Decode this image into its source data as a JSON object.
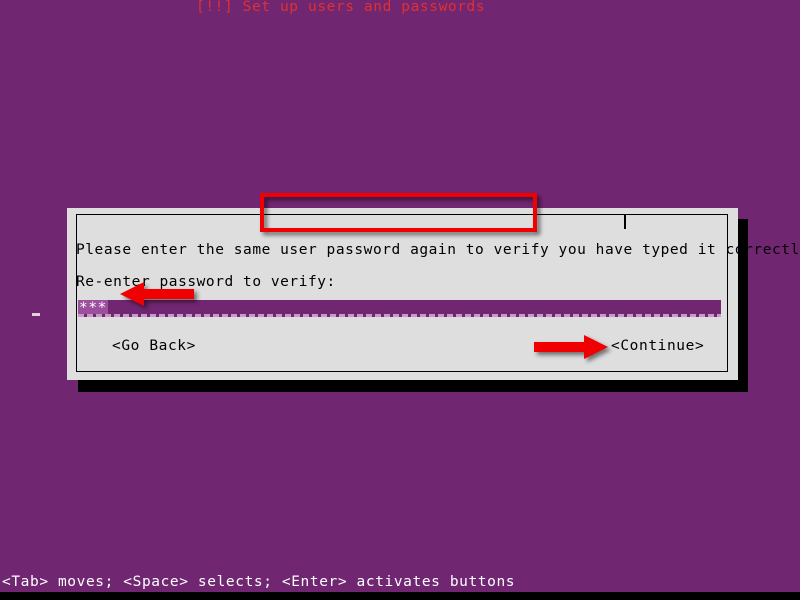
{
  "screen": {
    "background_color": "#712672",
    "shadow_color": "#000000"
  },
  "dialog": {
    "title": "[!!] Set up users and passwords",
    "title_color": "#e03030",
    "background_color": "#dedede",
    "border_color": "#000000",
    "prompt": "Please enter the same user password again to verify you have typed it correctly.",
    "field_label": "Re-enter password to verify:",
    "password_field": {
      "name": "Re-enter password to verify",
      "masked_value": "***",
      "character_count": 3,
      "mask_character": "*",
      "field_color": "#712672",
      "selection_color": "#9b4f9c",
      "cursor_visible": true
    },
    "buttons": [
      {
        "label": "<Go Back>",
        "name": "go-back"
      },
      {
        "label": "<Continue>",
        "name": "continue"
      }
    ],
    "go_back_label": "<Go Back>",
    "continue_label": "<Continue>"
  },
  "annotations": {
    "color": "#f00000",
    "title_highlight_box": "[!!] Set up users and passwords",
    "arrow_to_password_field": "left-arrow",
    "arrow_to_continue_button": "right-arrow"
  },
  "statusbar": {
    "text": "<Tab> moves; <Space> selects; <Enter> activates buttons",
    "text_color": "#ffffff"
  }
}
